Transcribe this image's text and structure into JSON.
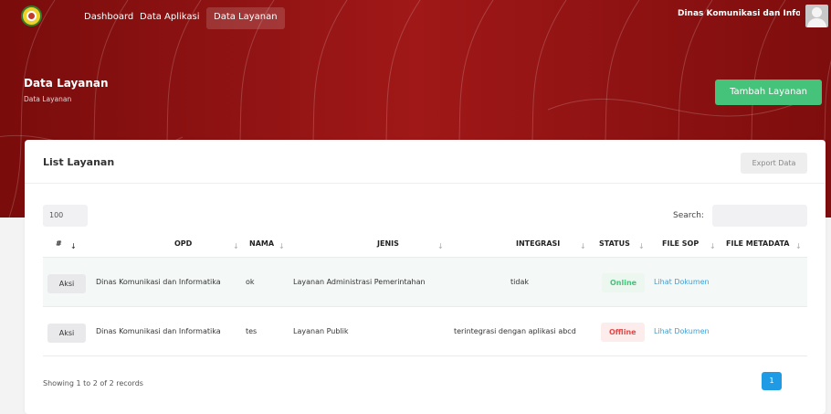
{
  "nav": {
    "items": [
      "Dashboard",
      "Data Aplikasi",
      "Data Layanan"
    ],
    "active": "Data Layanan",
    "user_name": "Dinas Komunikasi dan Info..."
  },
  "header": {
    "title": "Data Layanan",
    "breadcrumb": "Data Layanan",
    "add_button": "Tambah Layanan"
  },
  "card": {
    "title": "List Layanan",
    "export_button": "Export Data"
  },
  "controls": {
    "page_size": "100",
    "search_label": "Search:",
    "search_value": ""
  },
  "table": {
    "columns": [
      "#",
      "OPD",
      "NAMA",
      "JENIS",
      "INTEGRASI",
      "STATUS",
      "FILE SOP",
      "FILE METADATA"
    ],
    "sort_icon": "↓",
    "rows": [
      {
        "aksi": "Aksi",
        "opd": "Dinas Komunikasi dan Informatika",
        "nama": "ok",
        "jenis": "Layanan Administrasi Pemerintahan",
        "integrasi": "tidak",
        "status": "Online",
        "file_sop": "Lihat Dokumen",
        "file_metadata": ""
      },
      {
        "aksi": "Aksi",
        "opd": "Dinas Komunikasi dan Informatika",
        "nama": "tes",
        "jenis": "Layanan Publik",
        "integrasi": "terintegrasi dengan aplikasi abcd",
        "status": "Offline",
        "file_sop": "Lihat Dokumen",
        "file_metadata": ""
      }
    ]
  },
  "footer": {
    "info": "Showing 1 to 2 of 2 records",
    "current_page": "1"
  },
  "colors": {
    "hero": "#8e1010",
    "primary_button": "#46c37b",
    "online": "#46c37b",
    "offline": "#e04b4b",
    "link": "#3aa0d8",
    "pagination": "#1f9be6"
  }
}
